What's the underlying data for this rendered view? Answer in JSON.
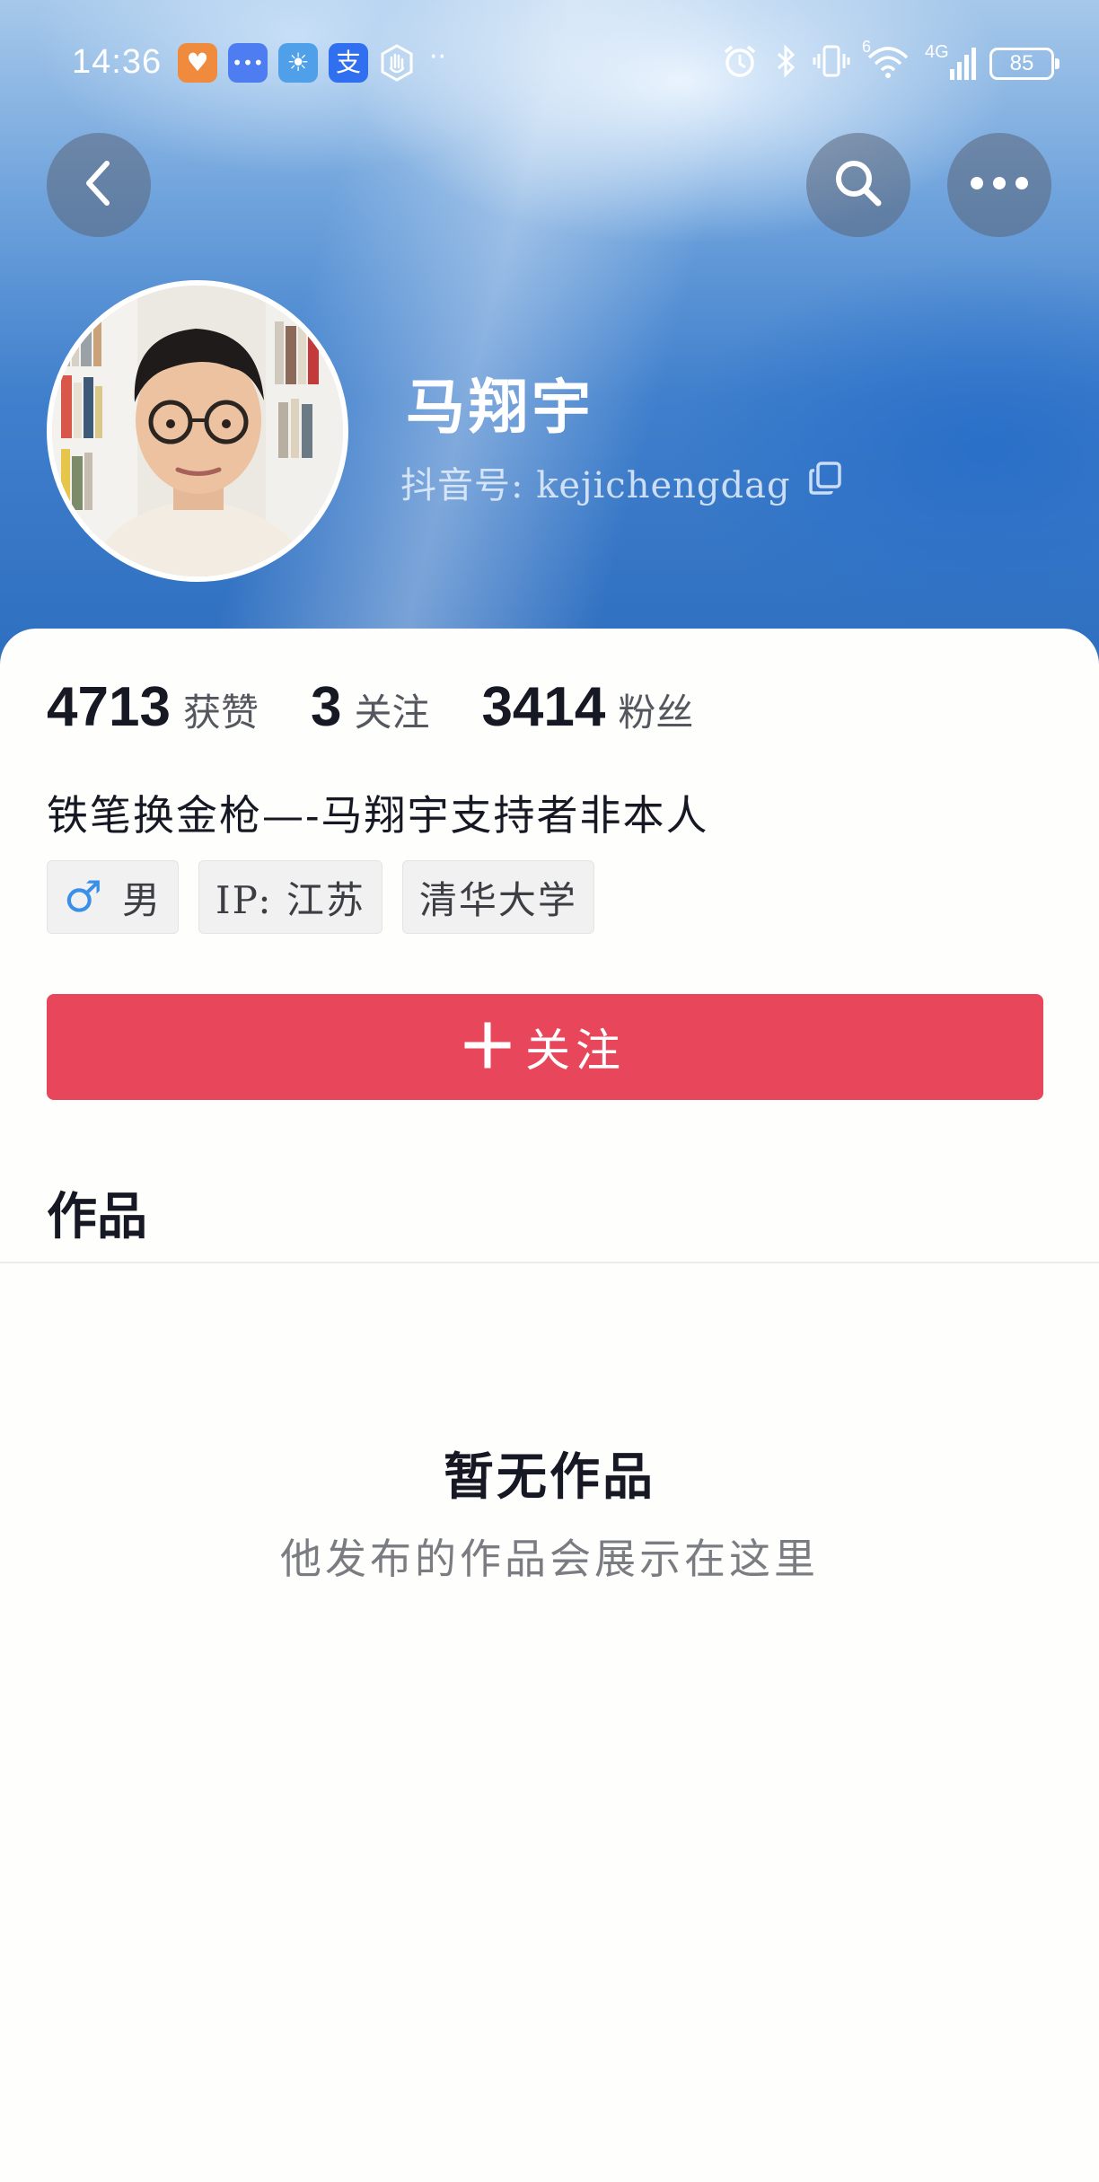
{
  "status_bar": {
    "time": "14:36",
    "overflow": "··",
    "network": "4G",
    "wifi_badge": "6",
    "battery": "85",
    "app_icons": [
      {
        "name": "taobao-app-icon",
        "glyph": "♥",
        "color": "#f08a3c"
      },
      {
        "name": "messages-app-icon",
        "glyph": "•••",
        "color": "#4d7df0"
      },
      {
        "name": "weather-app-icon",
        "glyph": "☀",
        "color": "#4fa0e8"
      },
      {
        "name": "alipay-app-icon",
        "glyph": "支",
        "color": "#2f6ff0"
      }
    ]
  },
  "profile": {
    "name": "马翔宇",
    "douyin_id": "抖音号: kejichengdag"
  },
  "stats": [
    {
      "value": "4713",
      "label": "获赞"
    },
    {
      "value": "3",
      "label": "关注"
    },
    {
      "value": "3414",
      "label": "粉丝"
    }
  ],
  "bio": "铁笔换金枪—-马翔宇支持者非本人",
  "tags": {
    "gender_symbol": "♂",
    "gender": "男",
    "ip": "IP: 江苏",
    "school": "清华大学"
  },
  "follow_button": {
    "label": "关注"
  },
  "works_tab": "作品",
  "empty_state": {
    "title": "暂无作品",
    "subtitle": "他发布的作品会展示在这里"
  },
  "colors": {
    "accent": "#e8465b",
    "gender_blue": "#3a8fe8"
  }
}
